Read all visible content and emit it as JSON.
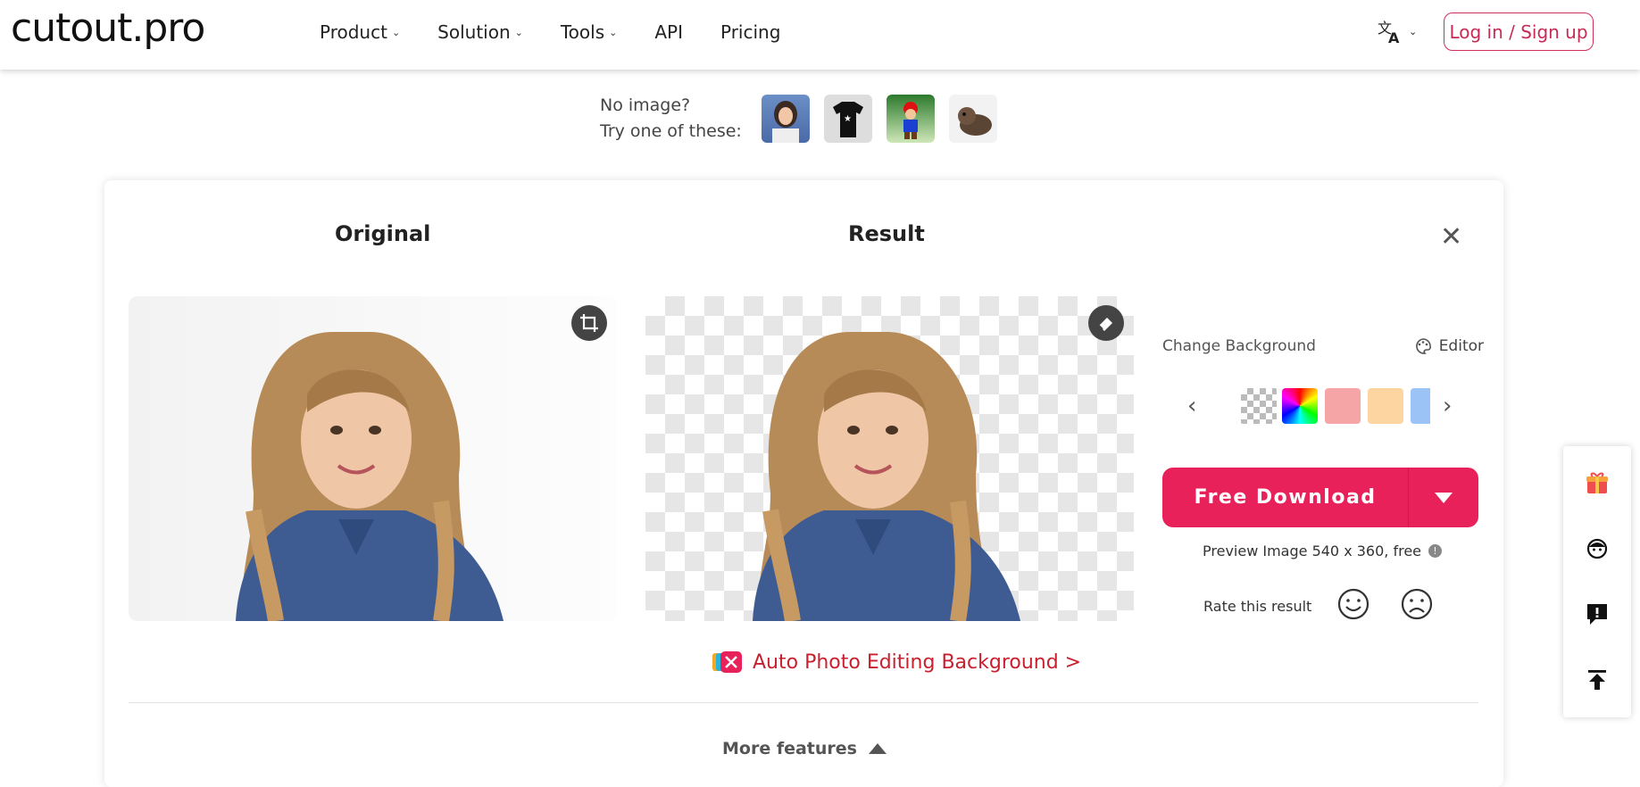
{
  "header": {
    "logo": "cutout.pro",
    "nav": [
      {
        "label": "Product",
        "dropdown": true
      },
      {
        "label": "Solution",
        "dropdown": true
      },
      {
        "label": "Tools",
        "dropdown": true
      },
      {
        "label": "API",
        "dropdown": false
      },
      {
        "label": "Pricing",
        "dropdown": false
      }
    ],
    "language_icon": "translate-icon",
    "login_label": "Log in / Sign up"
  },
  "samples": {
    "line1": "No image?",
    "line2": "Try one of these:",
    "items": [
      "girl-portrait",
      "black-tshirt",
      "mario-figure",
      "puppy"
    ]
  },
  "editor": {
    "original_title": "Original",
    "result_title": "Result",
    "change_background_label": "Change Background",
    "editor_label": "Editor",
    "background_options": [
      "transparent",
      "rainbow",
      "#f6a5a7",
      "#fdd5a0",
      "#9cc3f5"
    ],
    "download_label": "Free Download",
    "preview_info": "Preview Image 540 x 360, free",
    "rate_label": "Rate this result",
    "auto_link": "Auto Photo Editing Background >",
    "more_features": "More features"
  },
  "colors": {
    "accent": "#e8215a",
    "link_red": "#c8202e"
  }
}
